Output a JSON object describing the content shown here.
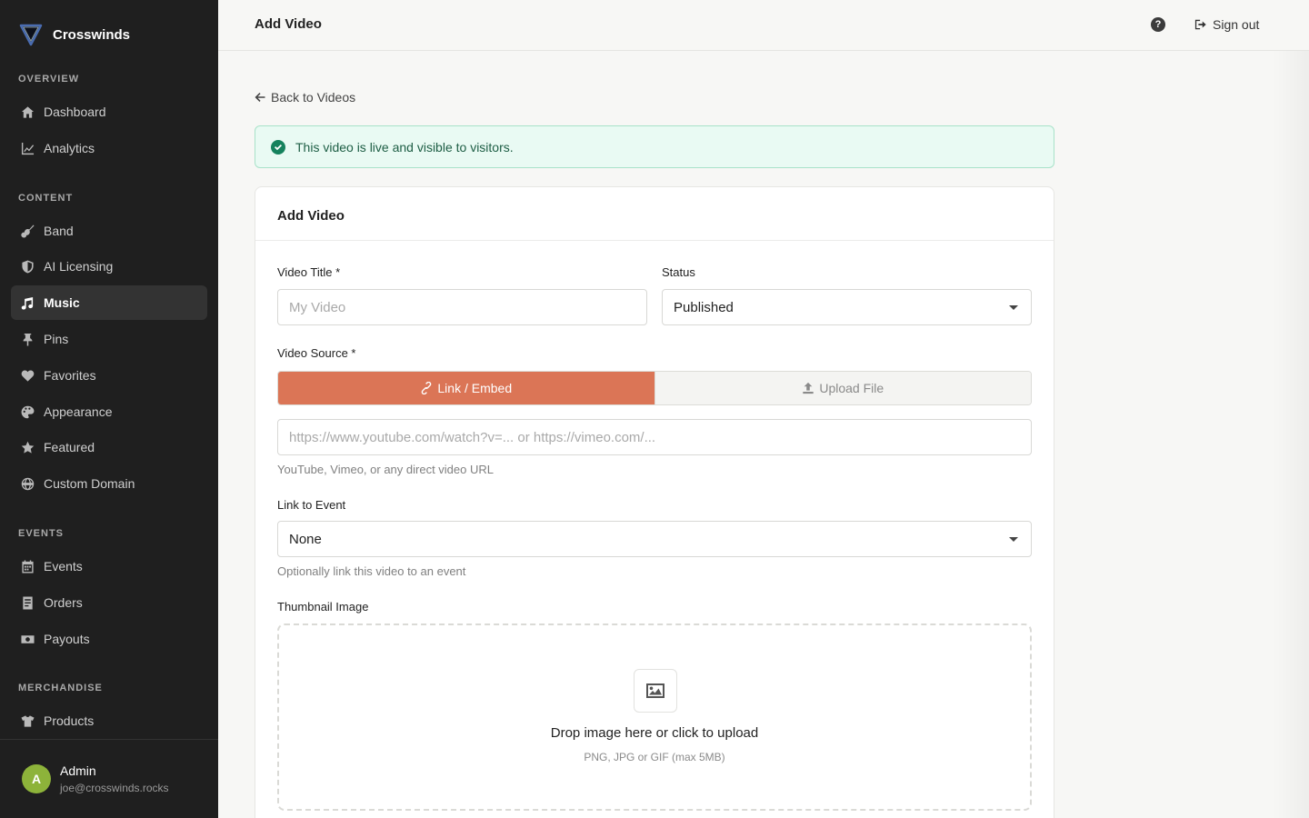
{
  "brand": {
    "name": "Crosswinds"
  },
  "sidebar": {
    "sections": [
      {
        "label": "OVERVIEW"
      },
      {
        "label": "CONTENT"
      },
      {
        "label": "EVENTS"
      },
      {
        "label": "MERCHANDISE"
      }
    ],
    "items": [
      {
        "label": "Dashboard",
        "icon": "home-icon"
      },
      {
        "label": "Analytics",
        "icon": "chart-line-icon"
      },
      {
        "label": "Band",
        "icon": "guitar-icon"
      },
      {
        "label": "AI Licensing",
        "icon": "shield-icon"
      },
      {
        "label": "Music",
        "icon": "music-note-icon",
        "active": true
      },
      {
        "label": "Pins",
        "icon": "pin-icon"
      },
      {
        "label": "Favorites",
        "icon": "heart-icon"
      },
      {
        "label": "Appearance",
        "icon": "palette-icon"
      },
      {
        "label": "Featured",
        "icon": "star-icon"
      },
      {
        "label": "Custom Domain",
        "icon": "globe-icon"
      },
      {
        "label": "Events",
        "icon": "calendar-icon"
      },
      {
        "label": "Orders",
        "icon": "receipt-icon"
      },
      {
        "label": "Payouts",
        "icon": "money-icon"
      },
      {
        "label": "Products",
        "icon": "shirt-icon"
      }
    ],
    "user": {
      "initial": "A",
      "name": "Admin",
      "email": "joe@crosswinds.rocks",
      "avatar_color": "#8db33a"
    }
  },
  "header": {
    "title": "Add Video",
    "help": "?",
    "signout_label": "Sign out"
  },
  "main": {
    "back_label": "Back to Videos",
    "alert": {
      "text": "This video is live and visible to visitors.",
      "color": "#16825d"
    },
    "card": {
      "title": "Add Video",
      "video_title": {
        "label": "Video Title *",
        "placeholder": "My Video",
        "value": ""
      },
      "status": {
        "label": "Status",
        "value": "Published"
      },
      "source": {
        "label": "Video Source *",
        "options": [
          {
            "label": "Link / Embed",
            "active": true,
            "icon": "link-icon"
          },
          {
            "label": "Upload File",
            "active": false,
            "icon": "upload-icon"
          }
        ],
        "url_placeholder": "https://www.youtube.com/watch?v=... or https://vimeo.com/...",
        "url_help": "YouTube, Vimeo, or any direct video URL"
      },
      "event": {
        "label": "Link to Event",
        "value": "None",
        "help": "Optionally link this video to an event"
      },
      "thumbnail": {
        "label": "Thumbnail Image",
        "drop_title": "Drop image here or click to upload",
        "drop_sub": "PNG, JPG or GIF (max 5MB)"
      }
    }
  },
  "colors": {
    "accent": "#db7556",
    "sidebar_bg": "#1f1f1f",
    "success_bg": "#e9faf3"
  }
}
